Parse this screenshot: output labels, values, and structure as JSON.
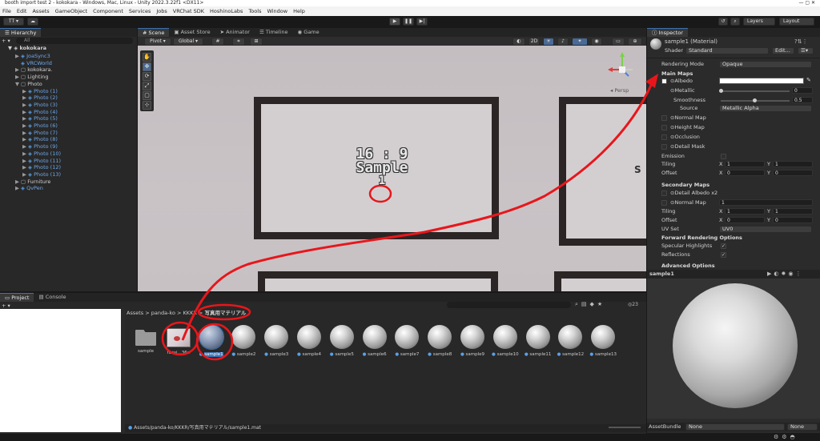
{
  "window": {
    "title": "booth import test 2 - kokokara - Windows, Mac, Linux - Unity 2022.3.22f1 <DX11>",
    "controls": "—   ▢   ✕"
  },
  "menu": [
    "File",
    "Edit",
    "Assets",
    "GameObject",
    "Component",
    "Services",
    "Jobs",
    "VRChat SDK",
    "HoshinoLabs",
    "Tools",
    "Window",
    "Help"
  ],
  "toolbar": {
    "account": "TT ▾",
    "cloud": "☁",
    "play": "▶",
    "pause": "❚❚",
    "step": "▶|",
    "history": "↺",
    "search": "⌕",
    "layers": "Layers",
    "layout": "Layout"
  },
  "hierarchy": {
    "tab": "Hierarchy",
    "add": "+ ▾",
    "search_placeholder": "All",
    "scene": "kokokara",
    "items": [
      {
        "label": "JoaSync3",
        "indent": 1,
        "blue": true,
        "arrow": "▶",
        "icon": "prefab"
      },
      {
        "label": "VRCWorld",
        "indent": 1,
        "blue": true,
        "arrow": "",
        "icon": "prefab"
      },
      {
        "label": "kokokara.",
        "indent": 1,
        "blue": false,
        "arrow": "▶",
        "icon": "obj"
      },
      {
        "label": "Lighting",
        "indent": 1,
        "blue": false,
        "arrow": "▶",
        "icon": "obj"
      },
      {
        "label": "Photo",
        "indent": 1,
        "blue": false,
        "arrow": "▼",
        "icon": "obj"
      },
      {
        "label": "Photo (1)",
        "indent": 2,
        "blue": true,
        "arrow": "▶",
        "icon": "prefab"
      },
      {
        "label": "Photo (2)",
        "indent": 2,
        "blue": true,
        "arrow": "▶",
        "icon": "prefab"
      },
      {
        "label": "Photo (3)",
        "indent": 2,
        "blue": true,
        "arrow": "▶",
        "icon": "prefab"
      },
      {
        "label": "Photo (4)",
        "indent": 2,
        "blue": true,
        "arrow": "▶",
        "icon": "prefab"
      },
      {
        "label": "Photo (5)",
        "indent": 2,
        "blue": true,
        "arrow": "▶",
        "icon": "prefab"
      },
      {
        "label": "Photo (6)",
        "indent": 2,
        "blue": true,
        "arrow": "▶",
        "icon": "prefab"
      },
      {
        "label": "Photo (7)",
        "indent": 2,
        "blue": true,
        "arrow": "▶",
        "icon": "prefab"
      },
      {
        "label": "Photo (8)",
        "indent": 2,
        "blue": true,
        "arrow": "▶",
        "icon": "prefab"
      },
      {
        "label": "Photo (9)",
        "indent": 2,
        "blue": true,
        "arrow": "▶",
        "icon": "prefab"
      },
      {
        "label": "Photo (10)",
        "indent": 2,
        "blue": true,
        "arrow": "▶",
        "icon": "prefab"
      },
      {
        "label": "Photo (11)",
        "indent": 2,
        "blue": true,
        "arrow": "▶",
        "icon": "prefab"
      },
      {
        "label": "Photo (12)",
        "indent": 2,
        "blue": true,
        "arrow": "▶",
        "icon": "prefab"
      },
      {
        "label": "Photo (13)",
        "indent": 2,
        "blue": true,
        "arrow": "▶",
        "icon": "prefab"
      },
      {
        "label": "Furniture",
        "indent": 1,
        "blue": false,
        "arrow": "▶",
        "icon": "obj"
      },
      {
        "label": "QvPen",
        "indent": 1,
        "blue": true,
        "arrow": "▶",
        "icon": "prefab"
      }
    ]
  },
  "scene": {
    "tabs": [
      "Scene",
      "Asset Store",
      "Animator",
      "Timeline",
      "Game"
    ],
    "pivot": "Pivot ▾",
    "global": "Global ▾",
    "twoD": "2D",
    "persp": "◂ Persp",
    "photo_text": [
      "16 : 9",
      "Sample",
      "1"
    ]
  },
  "project": {
    "tabs": [
      "Project",
      "Console"
    ],
    "add": "+ ▾",
    "breadcrumb": [
      "Assets",
      "panda-ko",
      "KKKR",
      "写真用マテリアル"
    ],
    "count": "23",
    "assets": [
      "sample",
      "facsi...36c",
      "sample1",
      "sample2",
      "sample3",
      "sample4",
      "sample5",
      "sample6",
      "sample7",
      "sample8",
      "sample9",
      "sample10",
      "sample11",
      "sample12",
      "sample13"
    ],
    "path": "Assets/panda-ko/KKKR/写真用マテリアル/sample1.mat"
  },
  "inspector": {
    "tab": "Inspector",
    "title": "sample1 (Material)",
    "shader_label": "Shader",
    "shader_value": "Standard",
    "edit": "Edit...",
    "rows": {
      "rendering_mode": "Rendering Mode",
      "rendering_value": "Opaque",
      "main_maps": "Main Maps",
      "albedo": "Albedo",
      "metallic": "Metallic",
      "metallic_value": "0",
      "smoothness": "Smoothness",
      "smoothness_value": "0.5",
      "source": "Source",
      "source_value": "Metallic Alpha",
      "normal_map": "Normal Map",
      "height_map": "Height Map",
      "occlusion": "Occlusion",
      "detail_mask": "Detail Mask",
      "emission": "Emission",
      "tiling": "Tiling",
      "offset": "Offset",
      "x_label": "X",
      "y_label": "Y",
      "tiling_x": "1",
      "tiling_y": "1",
      "offset_x": "0",
      "offset_y": "0",
      "secondary_maps": "Secondary Maps",
      "detail_albedo": "Detail Albedo x2",
      "normal_map2": "Normal Map",
      "normal2_value": "1",
      "tiling2_x": "1",
      "tiling2_y": "1",
      "offset2_x": "0",
      "offset2_y": "0",
      "uv_set": "UV Set",
      "uv_value": "UV0",
      "forward": "Forward Rendering Options",
      "specular": "Specular Highlights",
      "reflections": "Reflections",
      "advanced": "Advanced Options"
    },
    "preview_title": "sample1",
    "assetbundle_label": "AssetBundle",
    "assetbundle_value": "None",
    "assetbundle_variant": "None"
  },
  "colors": {
    "annotation": "#e8161b",
    "accent": "#3a72b0",
    "link": "#6fa7e8"
  }
}
